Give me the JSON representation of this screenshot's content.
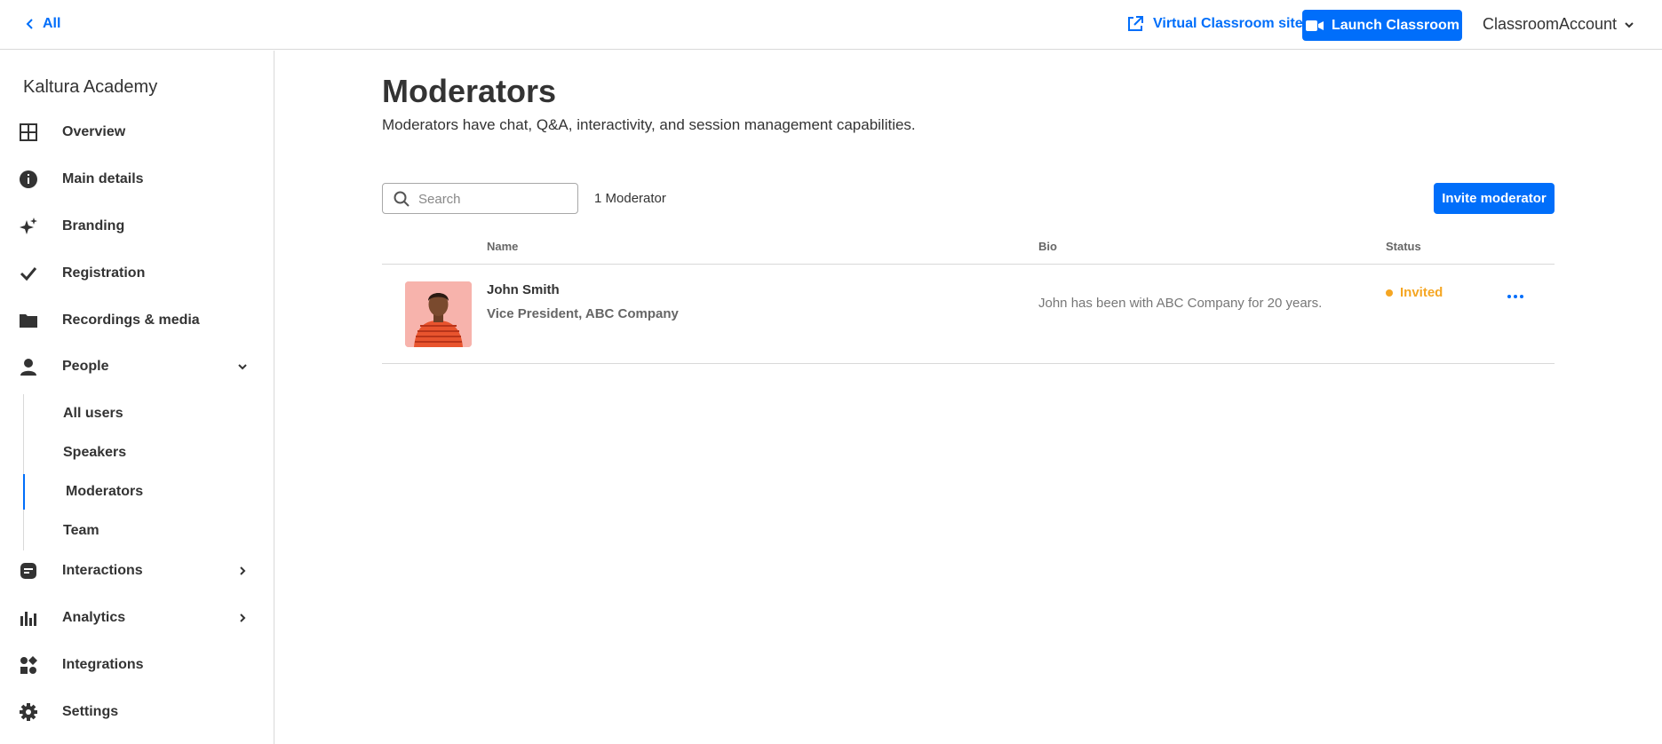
{
  "topbar": {
    "back_label": "All",
    "vc_site_label": "Virtual Classroom site",
    "launch_label": "Launch Classroom",
    "account_label": "ClassroomAccount"
  },
  "sidebar": {
    "org_name": "Kaltura Academy",
    "items": [
      {
        "label": "Overview",
        "icon": "grid-icon"
      },
      {
        "label": "Main details",
        "icon": "info-icon"
      },
      {
        "label": "Branding",
        "icon": "sparkle-icon"
      },
      {
        "label": "Registration",
        "icon": "check-icon"
      },
      {
        "label": "Recordings & media",
        "icon": "folder-icon"
      },
      {
        "label": "People",
        "icon": "person-icon"
      },
      {
        "label": "Interactions",
        "icon": "chat-icon"
      },
      {
        "label": "Analytics",
        "icon": "bar-chart-icon"
      },
      {
        "label": "Integrations",
        "icon": "integrations-icon"
      },
      {
        "label": "Settings",
        "icon": "gear-icon"
      }
    ],
    "people_sub": [
      {
        "label": "All users"
      },
      {
        "label": "Speakers"
      },
      {
        "label": "Moderators"
      },
      {
        "label": "Team"
      }
    ]
  },
  "main": {
    "title": "Moderators",
    "description": "Moderators have chat, Q&A, interactivity, and session management capabilities.",
    "search_placeholder": "Search",
    "count_text": "1 Moderator",
    "invite_label": "Invite moderator",
    "columns": {
      "name": "Name",
      "bio": "Bio",
      "status": "Status"
    },
    "rows": [
      {
        "name": "John Smith",
        "title": "Vice President, ABC Company",
        "bio": "John has been with ABC Company for 20 years.",
        "status": "Invited"
      }
    ]
  },
  "colors": {
    "accent": "#006efa",
    "status_invited": "#f5a623"
  }
}
